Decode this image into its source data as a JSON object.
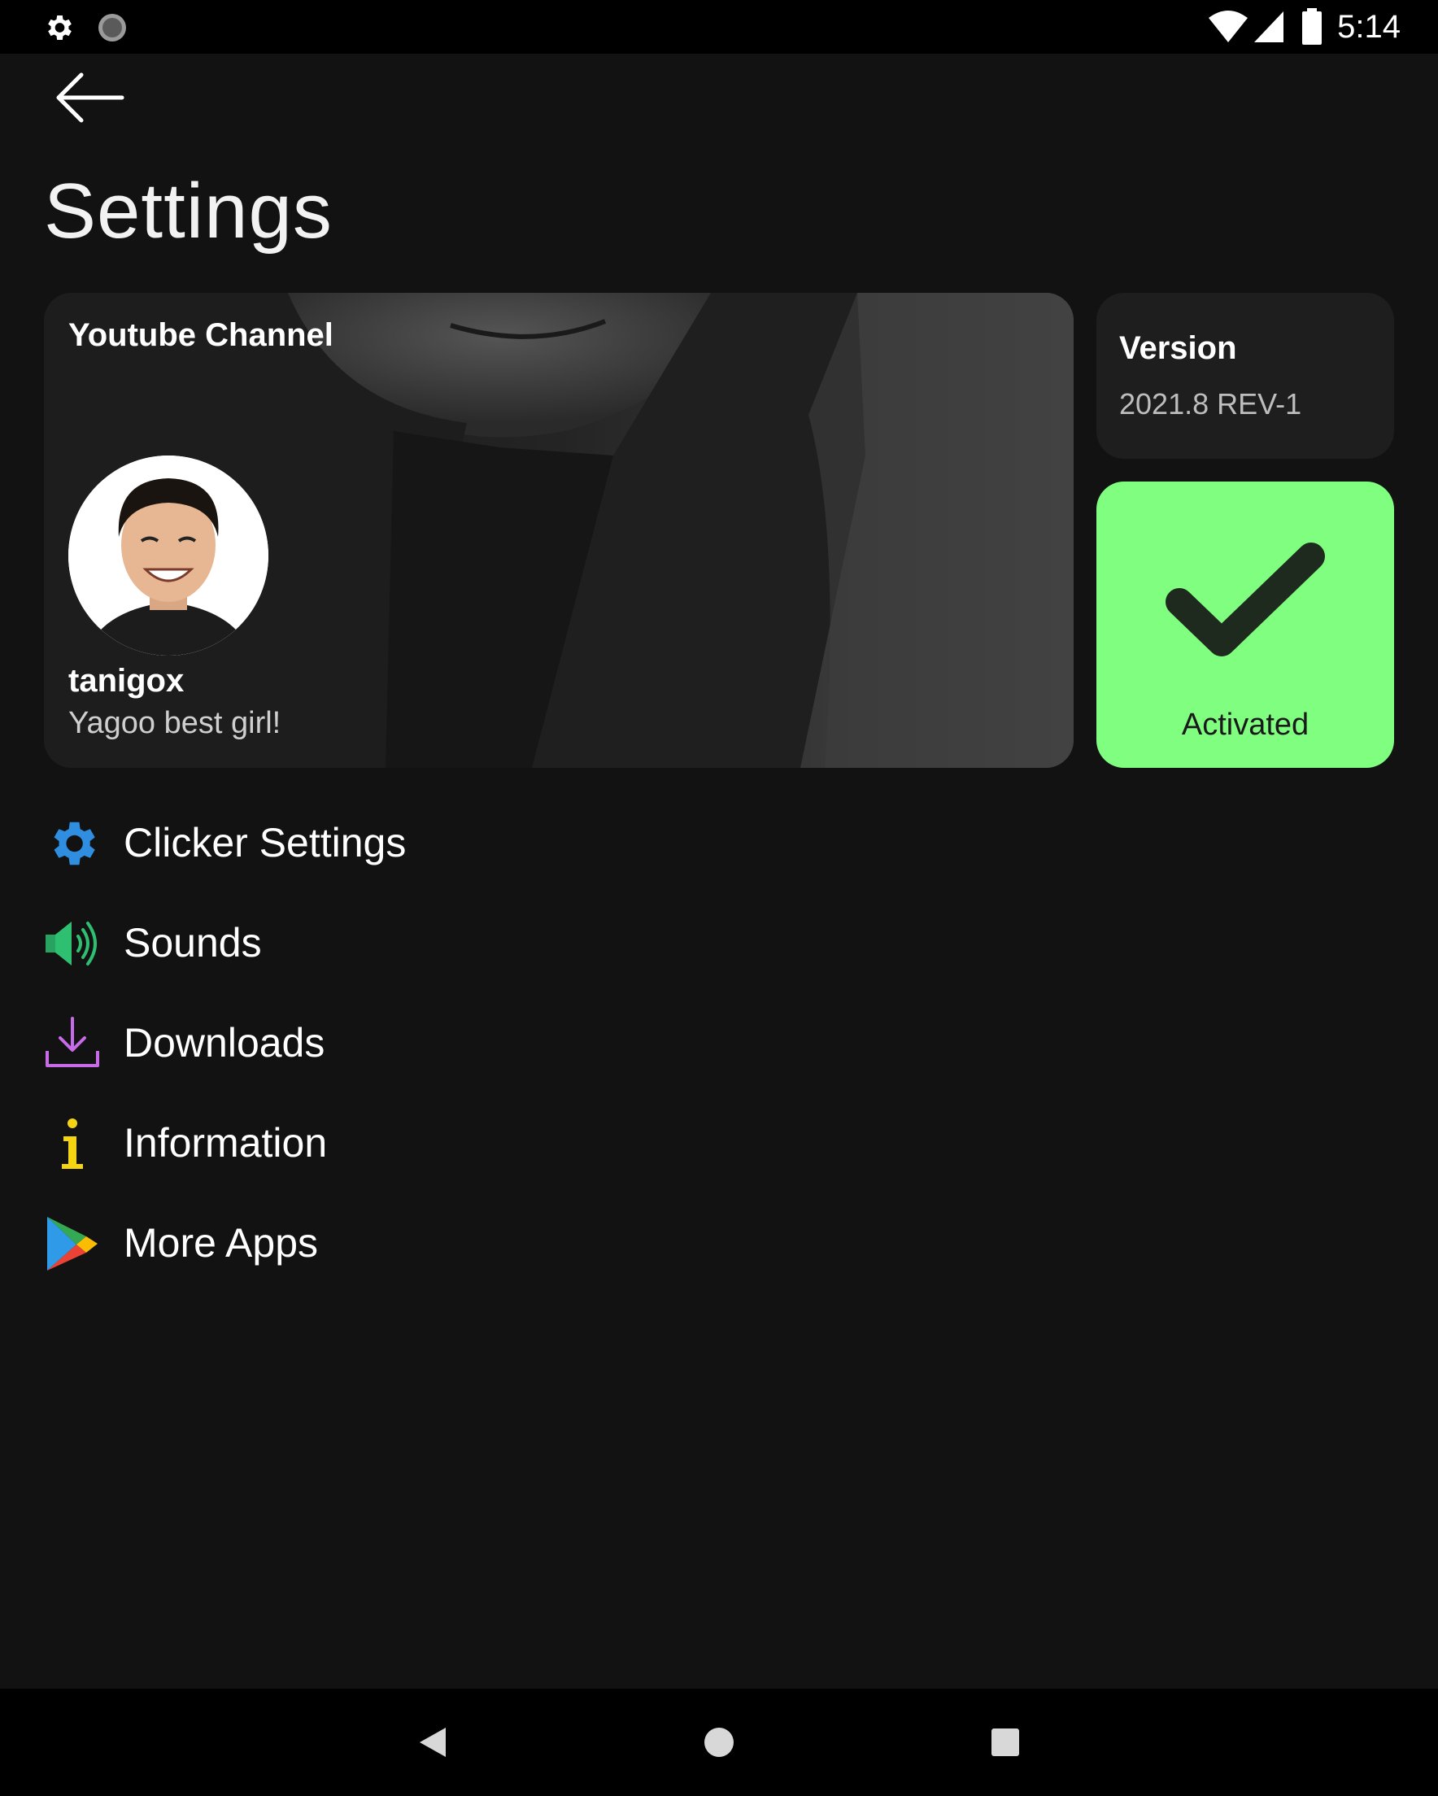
{
  "status_bar": {
    "time": "5:14",
    "left_icons": [
      "gear-icon",
      "spinner-icon"
    ],
    "right_icons": [
      "wifi-icon",
      "signal-icon",
      "battery-icon"
    ]
  },
  "header": {
    "back_icon": "arrow-left-icon",
    "title": "Settings"
  },
  "channel_card": {
    "label": "Youtube Channel",
    "name": "tanigox",
    "description": "Yagoo best girl!"
  },
  "version_card": {
    "title": "Version",
    "value": "2021.8 REV-1"
  },
  "activated_card": {
    "label": "Activated",
    "color": "#80fe80"
  },
  "menu": {
    "items": [
      {
        "label": "Clicker Settings",
        "icon": "gear-icon",
        "color": "#2f8ee0"
      },
      {
        "label": "Sounds",
        "icon": "speaker-icon",
        "color": "#2fbf71"
      },
      {
        "label": "Downloads",
        "icon": "download-icon",
        "color": "#c86be8"
      },
      {
        "label": "Information",
        "icon": "info-icon",
        "color": "#f5d414"
      },
      {
        "label": "More Apps",
        "icon": "play-store-icon",
        "color": "#34a853"
      }
    ]
  },
  "nav_bar": {
    "buttons": [
      "back-triangle-icon",
      "home-circle-icon",
      "recents-square-icon"
    ]
  }
}
